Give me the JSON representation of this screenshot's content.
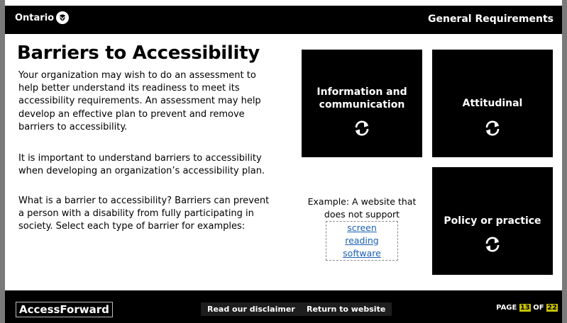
{
  "header": {
    "brand": "Ontario",
    "section_title": "General Requirements"
  },
  "main": {
    "title": "Barriers to Accessibility",
    "paragraph1": "Your organization may wish to do an assessment to help better understand its readiness to meet its accessibility requirements. An assessment may help develop an effective plan to prevent and remove barriers to accessibility.",
    "paragraph2": "It is important to understand barriers to accessibility when developing an organization’s accessibility plan.",
    "paragraph3": "What is a barrier to accessibility? Barriers can prevent a person with a disability from fully participating in society. Select each type of barrier for examples:"
  },
  "cards": [
    {
      "label": "Information and communication",
      "icon": "flip-arrows-icon"
    },
    {
      "label": "Attitudinal",
      "icon": "flip-arrows-icon"
    },
    {
      "label": "Policy or practice",
      "icon": "flip-arrows-icon"
    }
  ],
  "example": {
    "text": "Example: A website that does not support",
    "link": "screen reading software"
  },
  "footer": {
    "brand": "AccessForward",
    "disclaimer_label": "Read our disclaimer",
    "return_label": "Return to website",
    "page_prefix": "PAGE",
    "page_current": "13",
    "page_of": "OF",
    "page_total": "22"
  },
  "colors": {
    "background": "#ffffff",
    "bar": "#000000",
    "frame": "#7a7a7a",
    "link": "#1a5fb4",
    "page_highlight": "#c8c400"
  }
}
